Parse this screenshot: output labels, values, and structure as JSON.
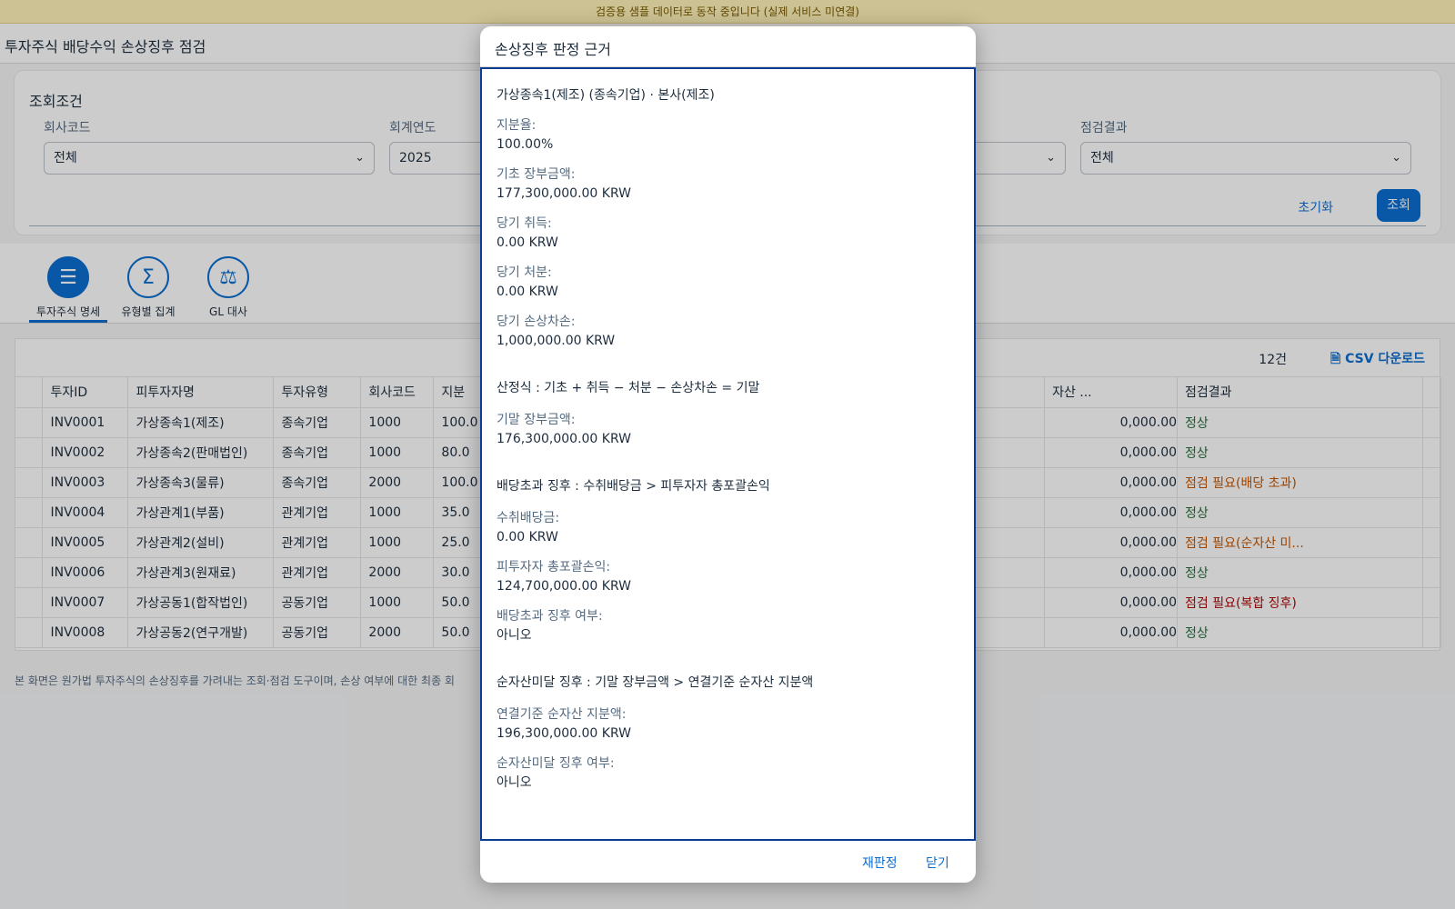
{
  "banner": {
    "text": "검증용 샘플 데이터로 동작 중입니다 (실제 서비스 미연결)"
  },
  "page": {
    "title": "투자주식 배당수익 손상징후 점검"
  },
  "filter": {
    "title": "조회조건",
    "fields": [
      {
        "label": "회사코드",
        "value": "전체"
      },
      {
        "label": "회계연도",
        "value": "2025"
      },
      {
        "label": "",
        "value": ""
      },
      {
        "label": "점검결과",
        "value": "전체"
      }
    ],
    "reset_label": "초기화",
    "go_label": "조회"
  },
  "tabs": [
    {
      "label": "투자주식 명세",
      "icon": "list-icon",
      "active": true
    },
    {
      "label": "유형별 집계",
      "icon": "sigma-icon",
      "active": false
    },
    {
      "label": "GL 대사",
      "icon": "balance-scale-icon",
      "active": false
    }
  ],
  "table": {
    "count": "12건",
    "csv_label": "CSV 다운로드",
    "columns": [
      "투자ID",
      "피투자자명",
      "투자유형",
      "회사코드",
      "지분",
      "자산 ...",
      "점검결과"
    ],
    "rows": [
      {
        "id": "INV0001",
        "name": "가상종속1(제조)",
        "type": "종속기업",
        "company": "1000",
        "share": "100.0",
        "amount": "0,000.00",
        "result": "정상",
        "status": "ok"
      },
      {
        "id": "INV0002",
        "name": "가상종속2(판매법인)",
        "type": "종속기업",
        "company": "1000",
        "share": "80.0",
        "amount": "0,000.00",
        "result": "정상",
        "status": "ok"
      },
      {
        "id": "INV0003",
        "name": "가상종속3(물류)",
        "type": "종속기업",
        "company": "2000",
        "share": "100.0",
        "amount": "0,000.00",
        "result": "점검 필요(배당 초과)",
        "status": "warn"
      },
      {
        "id": "INV0004",
        "name": "가상관계1(부품)",
        "type": "관계기업",
        "company": "1000",
        "share": "35.0",
        "amount": "0,000.00",
        "result": "정상",
        "status": "ok"
      },
      {
        "id": "INV0005",
        "name": "가상관계2(설비)",
        "type": "관계기업",
        "company": "1000",
        "share": "25.0",
        "amount": "0,000.00",
        "result": "점검 필요(순자산 미...",
        "status": "warn"
      },
      {
        "id": "INV0006",
        "name": "가상관계3(원재료)",
        "type": "관계기업",
        "company": "2000",
        "share": "30.0",
        "amount": "0,000.00",
        "result": "정상",
        "status": "ok"
      },
      {
        "id": "INV0007",
        "name": "가상공동1(합작법인)",
        "type": "공동기업",
        "company": "1000",
        "share": "50.0",
        "amount": "0,000.00",
        "result": "점검 필요(복합 징후)",
        "status": "err"
      },
      {
        "id": "INV0008",
        "name": "가상공동2(연구개발)",
        "type": "공동기업",
        "company": "2000",
        "share": "50.0",
        "amount": "0,000.00",
        "result": "정상",
        "status": "ok"
      }
    ]
  },
  "footnote": "본 화면은 원가법 투자주식의 손상징후를 가려내는 조회·점검 도구이며, 손상 여부에 대한 최종 회",
  "dialog": {
    "title": "손상징후 판정 근거",
    "entity": "가상종속1(제조) (종속기업) · 본사(제조)",
    "group1": [
      {
        "label": "지분율:",
        "value": "100.00%"
      },
      {
        "label": "기초 장부금액:",
        "value": "177,300,000.00 KRW"
      },
      {
        "label": "당기 취득:",
        "value": "0.00 KRW"
      },
      {
        "label": "당기 처분:",
        "value": "0.00 KRW"
      },
      {
        "label": "당기 손상차손:",
        "value": "1,000,000.00 KRW"
      }
    ],
    "formula": "산정식 : 기초 + 취득 − 처분 − 손상차손 = 기말",
    "group2": [
      {
        "label": "기말 장부금액:",
        "value": "176,300,000.00 KRW"
      }
    ],
    "section2": "배당초과 징후 : 수취배당금 > 피투자자 총포괄손익",
    "group3": [
      {
        "label": "수취배당금:",
        "value": "0.00 KRW"
      },
      {
        "label": "피투자자 총포괄손익:",
        "value": "124,700,000.00 KRW"
      },
      {
        "label": "배당초과 징후 여부:",
        "value": "아니오"
      }
    ],
    "section3": "순자산미달 징후 : 기말 장부금액 > 연결기준 순자산 지분액",
    "group4": [
      {
        "label": "연결기준 순자산 지분액:",
        "value": "196,300,000.00 KRW"
      },
      {
        "label": "순자산미달 징후 여부:",
        "value": "아니오"
      }
    ],
    "rejudge_label": "재판정",
    "close_label": "닫기"
  }
}
